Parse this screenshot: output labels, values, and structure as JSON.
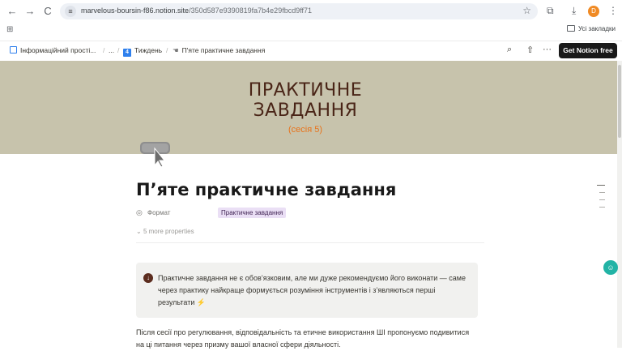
{
  "browser": {
    "back_glyph": "←",
    "forward_glyph": "→",
    "reload_glyph": "C",
    "url_host": "marvelous-boursin-f86.notion.site",
    "url_path": "/350d587e9390819fa7b4e29fbcd9ff71",
    "star_glyph": "☆",
    "extensions_glyph": "⧉",
    "download_glyph": "⤓",
    "profile_initial": "D",
    "menu_glyph": "⋮",
    "apps_glyph": "⊞",
    "all_bookmarks_label": "Усі закладки"
  },
  "topbar": {
    "breadcrumbs": [
      {
        "label": "Інформаційний прості..."
      },
      {
        "label": "..."
      },
      {
        "label": "Тиждень",
        "badge": "4"
      },
      {
        "label": "П'яте практичне завдання"
      }
    ],
    "separator": "/",
    "search_glyph": "⌕",
    "share_glyph": "⇧",
    "more_glyph": "···",
    "get_notion_free_label": "Get Notion free"
  },
  "cover": {
    "title_line1": "ПРАКТИЧНЕ",
    "title_line2": "ЗАВДАННЯ",
    "subtitle": "(сесія 5)",
    "background_color": "#c7c3ac",
    "title_color": "#4a2517",
    "subtitle_color": "#e8731b"
  },
  "page": {
    "icon_name": "hand-pointer-icon",
    "title": "П’яте практичне завдання",
    "properties": [
      {
        "icon": "◎",
        "name": "Формат",
        "value": "Практичне завдання"
      }
    ],
    "more_properties_label": "5 more properties",
    "callout": {
      "icon_glyph": "↓",
      "text": "Практичне завдання не є обов’язковим, але ми дуже рекомендуємо його виконати — саме через практику найкраще формується розуміння інструментів і з’являються перші результати",
      "trailing_emoji": "⚡"
    },
    "body_paragraph": "Після сесії про регулювання, відповідальність та етичне використання ШІ пропонуємо подивитися на ці питання через призму вашої власної сфери діяльності."
  },
  "chat_fab_glyph": "☺",
  "colors": {
    "accent_blue": "#2f80ed",
    "tag_bg": "#eadff5",
    "button_dark": "#191919",
    "chat_fab": "#22b3a5"
  }
}
